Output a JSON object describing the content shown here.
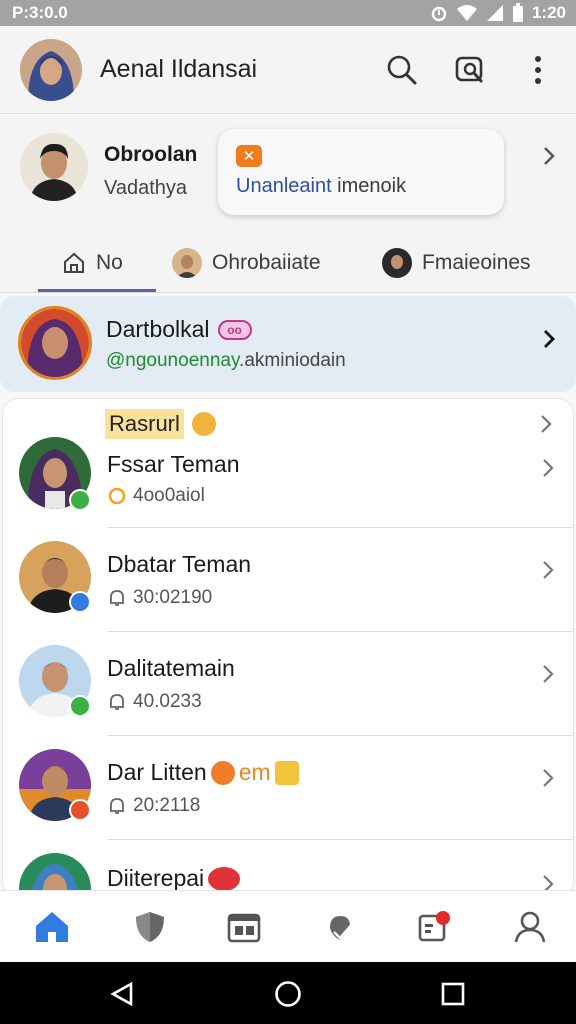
{
  "status_bar": {
    "time": "P:3:0.0",
    "clock": "1:20"
  },
  "app_bar": {
    "title": "Aenal Ildansai"
  },
  "profile": {
    "name": "Obroolan",
    "subtitle": "Vadathya",
    "status_text_main": "Unanleaint",
    "status_text_rest": " imenoik"
  },
  "tabs": [
    {
      "label": "No"
    },
    {
      "label": "Ohrobaiiate"
    },
    {
      "label": "Fmaieoines"
    }
  ],
  "highlighted_chat": {
    "name": "Dartbolkal",
    "pill": "oo",
    "subtitle_green": "@ngounoennay",
    "subtitle_rest": ".akminiodain"
  },
  "list": {
    "section_tag": "Rasrurl",
    "items": [
      {
        "name": "Fssar Teman",
        "meta": "4oo0aiol"
      },
      {
        "name": "Dbatar Teman",
        "meta": "30:02190"
      },
      {
        "name": "Dalitatemain",
        "meta": "40.0233"
      },
      {
        "name": "Dar Litten",
        "name_suffix": "em",
        "meta": "20:2118"
      },
      {
        "name": "Diiterepai",
        "meta": ""
      }
    ]
  },
  "colors": {
    "accent": "#5b5fa8",
    "home_active": "#2f7de1",
    "green_online": "#3cb043",
    "highlight_bg": "#e3ecf4"
  }
}
